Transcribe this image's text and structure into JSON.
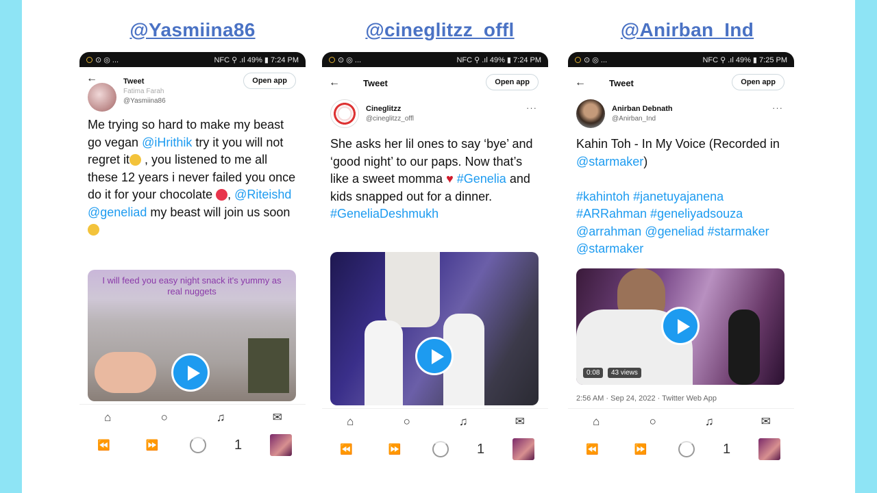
{
  "colors": {
    "side_strip": "#8ee4f5",
    "handle": "#4a72c4",
    "link": "#1d9bf0",
    "play": "#1d9bf0"
  },
  "panels": [
    {
      "handle": "@Yasmiina86",
      "status_left": "⊙ ◎ ...",
      "status_right": "NFC ⚲ .ıl 49% ▮ 7:24 PM",
      "title": "Tweet",
      "open_app": "Open app",
      "author_name": "Tweet",
      "author_sub": "Fatima Farah",
      "author_handle": "@Yasmiina86",
      "text_segments": [
        {
          "t": "Me trying so hard to make my beast go vegan "
        },
        {
          "t": "@iHrithik",
          "link": true
        },
        {
          "t": " try it you will not regret it"
        },
        {
          "emoji": "#f3c33b"
        },
        {
          "t": " , you listened to me all these 12 years i never failed you once do it for your chocolate "
        },
        {
          "emoji": "#e8354c"
        },
        {
          "t": ", "
        },
        {
          "t": "@Riteishd",
          "link": true
        },
        {
          "t": " "
        },
        {
          "t": "@geneliad",
          "link": true
        },
        {
          "t": " my beast will join us soon"
        },
        {
          "emoji": "#f3c33b"
        }
      ],
      "media_caption": "I will feed you easy night snack it's yummy as real nuggets",
      "nav_icons": [
        "home-icon",
        "search-icon",
        "bell-icon",
        "mail-icon"
      ],
      "tab_count": "1"
    },
    {
      "handle": "@cineglitzz_offl",
      "status_left": "⊙ ◎ ...",
      "status_right": "NFC ⚲ .ıl 49% ▮ 7:24 PM",
      "title": "Tweet",
      "open_app": "Open app",
      "author_name": "Cineglitzz",
      "author_handle": "@cineglitzz_offl",
      "more": "···",
      "text_segments": [
        {
          "t": "She asks her lil ones to say ‘bye’ and ‘good night’ to our paps. Now that’s like a sweet momma "
        },
        {
          "heart": true
        },
        {
          "t": " "
        },
        {
          "t": "#Genelia",
          "link": true
        },
        {
          "t": " and kids snapped out for a dinner. "
        },
        {
          "t": "#GeneliaDeshmukh",
          "link": true
        }
      ],
      "nav_icons": [
        "home-icon",
        "search-icon",
        "bell-icon",
        "mail-icon"
      ],
      "tab_count": "1"
    },
    {
      "handle": "@Anirban_Ind",
      "status_left": "⊙ ◎ ...",
      "status_right": "NFC ⚲ .ıl 49% ▮ 7:25 PM",
      "title": "Tweet",
      "open_app": "Open app",
      "author_name": "Anirban Debnath",
      "author_handle": "@Anirban_Ind",
      "more": "···",
      "text_segments": [
        {
          "t": "Kahin Toh - In My Voice (Recorded in "
        },
        {
          "t": "@starmaker",
          "link": true
        },
        {
          "t": ")"
        },
        {
          "br": true
        },
        {
          "br": true
        },
        {
          "t": "#kahintoh #janetuyajanena #ARRahman #geneliyadsouza @arrahman @geneliad #starmaker @starmaker",
          "link": true
        }
      ],
      "video_time": "0:08",
      "video_views": "43 views",
      "timestamp": "2:56 AM · Sep 24, 2022 · Twitter Web App",
      "nav_icons": [
        "home-icon",
        "search-icon",
        "bell-icon",
        "mail-icon"
      ],
      "tab_count": "1"
    }
  ]
}
